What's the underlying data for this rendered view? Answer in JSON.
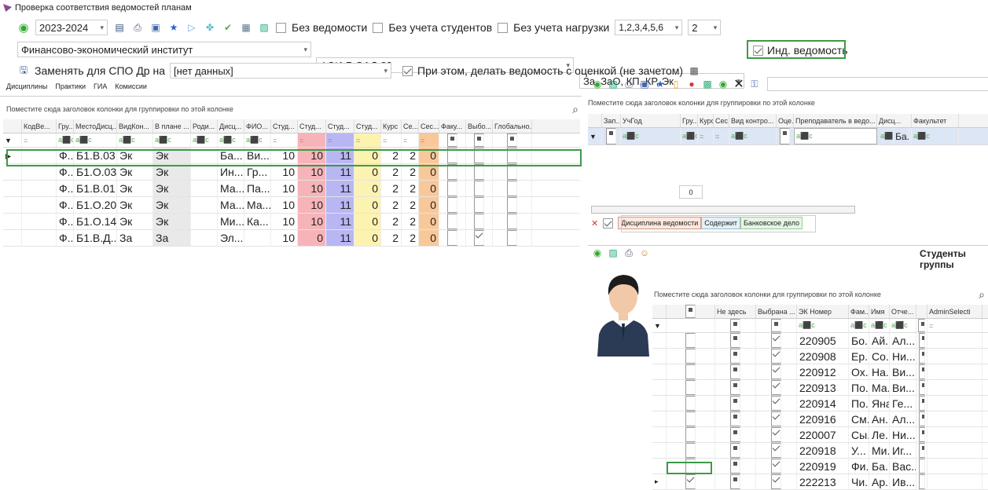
{
  "window": {
    "title": "Проверка соответствия ведомостей планам"
  },
  "toolbar": {
    "year": "2023-2024",
    "no_statement": "Без ведомости",
    "no_students": "Без учета студентов",
    "no_load": "Без учета нагрузки",
    "terms": "1,2,3,4,5,6",
    "course": "2",
    "institute": "Финансово-экономический институт",
    "group": "ФЭИ-Б-ЭАД-22",
    "control_types": "За, ЗаО, КП, КР, Эк",
    "ind_statement": "Инд. ведомость",
    "replace_spo": "Заменять для СПО Др на",
    "no_data": "[нет данных]",
    "make_graded": "При этом, делать ведомость с оценкой (не зачетом)"
  },
  "left_tabs": [
    "Дисциплины",
    "Практики",
    "ГИА",
    "Комиссии"
  ],
  "group_hint": "Поместите сюда заголовок колонки для группировки по этой колонке",
  "left_grid": {
    "columns": [
      "КодВе...",
      "Гру...",
      "МестоДисц...",
      "ВидКон...",
      "В плане ...",
      "Роди...",
      "Дисц...",
      "ФИО...",
      "Студ...",
      "Студ...",
      "Студ...",
      "Студ...",
      "Курс",
      "Се...",
      "Сес...",
      "Факу...",
      "Выбо...",
      "Глобально..."
    ],
    "rows": [
      {
        "g": "Ф...",
        "place": "Б1.В.03",
        "vk": "Эк",
        "vp": "Эк",
        "disc": "Ба...",
        "fio": "Ви...",
        "s1": "10",
        "s2": "10",
        "s3": "11",
        "s4": "0",
        "course": "2",
        "se": "2",
        "ses": "0",
        "vyb": false
      },
      {
        "g": "Ф...",
        "place": "Б1.О.03",
        "vk": "Эк",
        "vp": "Эк",
        "disc": "Ин...",
        "fio": "Гр...",
        "s1": "10",
        "s2": "10",
        "s3": "11",
        "s4": "0",
        "course": "2",
        "se": "2",
        "ses": "0",
        "vyb": false
      },
      {
        "g": "Ф...",
        "place": "Б1.В.01",
        "vk": "Эк",
        "vp": "Эк",
        "disc": "Ма...",
        "fio": "Па...",
        "s1": "10",
        "s2": "10",
        "s3": "11",
        "s4": "0",
        "course": "2",
        "se": "2",
        "ses": "0",
        "vyb": false
      },
      {
        "g": "Ф...",
        "place": "Б1.О.20",
        "vk": "Эк",
        "vp": "Эк",
        "disc": "Ма...",
        "fio": "Ма...",
        "s1": "10",
        "s2": "10",
        "s3": "11",
        "s4": "0",
        "course": "2",
        "se": "2",
        "ses": "0",
        "vyb": false
      },
      {
        "g": "Ф...",
        "place": "Б1.О.14",
        "vk": "Эк",
        "vp": "Эк",
        "disc": "Ми...",
        "fio": "Ка...",
        "s1": "10",
        "s2": "10",
        "s3": "11",
        "s4": "0",
        "course": "2",
        "se": "2",
        "ses": "0",
        "vyb": false
      },
      {
        "g": "Ф...",
        "place": "Б1.В.Д...",
        "vk": "За",
        "vp": "За",
        "disc": "Эл...",
        "fio": "",
        "s1": "10",
        "s2": "0",
        "s3": "11",
        "s4": "0",
        "course": "2",
        "se": "2",
        "ses": "0",
        "vyb": true
      }
    ]
  },
  "right_top_grid": {
    "columns": [
      "Зап...",
      "УчГод",
      "Гру...",
      "Курс",
      "Сес...",
      "Вид контро...",
      "Оце...",
      "Преподаватель в ведо...",
      "Дисц...",
      "Факультет"
    ],
    "filter_disc": "Ба...",
    "count": "0",
    "filter_chips": [
      "Дисциплина ведомости",
      "Содержит",
      "Банковское дело"
    ]
  },
  "students": {
    "title": "Студенты группы",
    "columns": [
      "Не здесь",
      "Выбрана ...",
      "ЭК Номер",
      "Фам...",
      "Имя",
      "Отче...",
      "",
      "AdminSelecti"
    ],
    "rows": [
      {
        "num": "220905",
        "fam": "Бо...",
        "name": "Ай...",
        "otch": "Ал...",
        "sel": false,
        "adm": true
      },
      {
        "num": "220908",
        "fam": "Ер...",
        "name": "Со...",
        "otch": "Ни...",
        "sel": false,
        "adm": true
      },
      {
        "num": "220912",
        "fam": "Ох...",
        "name": "На...",
        "otch": "Ви...",
        "sel": false,
        "adm": true
      },
      {
        "num": "220913",
        "fam": "По...",
        "name": "Ма...",
        "otch": "Ви...",
        "sel": false,
        "adm": true
      },
      {
        "num": "220914",
        "fam": "По...",
        "name": "Яна",
        "otch": "Ге...",
        "sel": false,
        "adm": true
      },
      {
        "num": "220916",
        "fam": "См...",
        "name": "Ан...",
        "otch": "Ал...",
        "sel": false,
        "adm": true
      },
      {
        "num": "220007",
        "fam": "Сы...",
        "name": "Ле...",
        "otch": "Ни...",
        "sel": false,
        "adm": true
      },
      {
        "num": "220918",
        "fam": "У...",
        "name": "Ми...",
        "otch": "Иг...",
        "sel": false,
        "adm": true
      },
      {
        "num": "220919",
        "fam": "Фи...",
        "name": "Ба...",
        "otch": "Вас...",
        "sel": false,
        "adm": false
      },
      {
        "num": "222213",
        "fam": "Чи...",
        "name": "Ар...",
        "otch": "Ив...",
        "sel": true,
        "adm": false
      }
    ]
  },
  "colors": {
    "accent_box": "#3c9b46",
    "pink": "#f7b4b8",
    "lavender": "#b9b6f4",
    "yellow": "#fdf3b0",
    "orange": "#f9c89a",
    "selected": "#dde6f4"
  }
}
